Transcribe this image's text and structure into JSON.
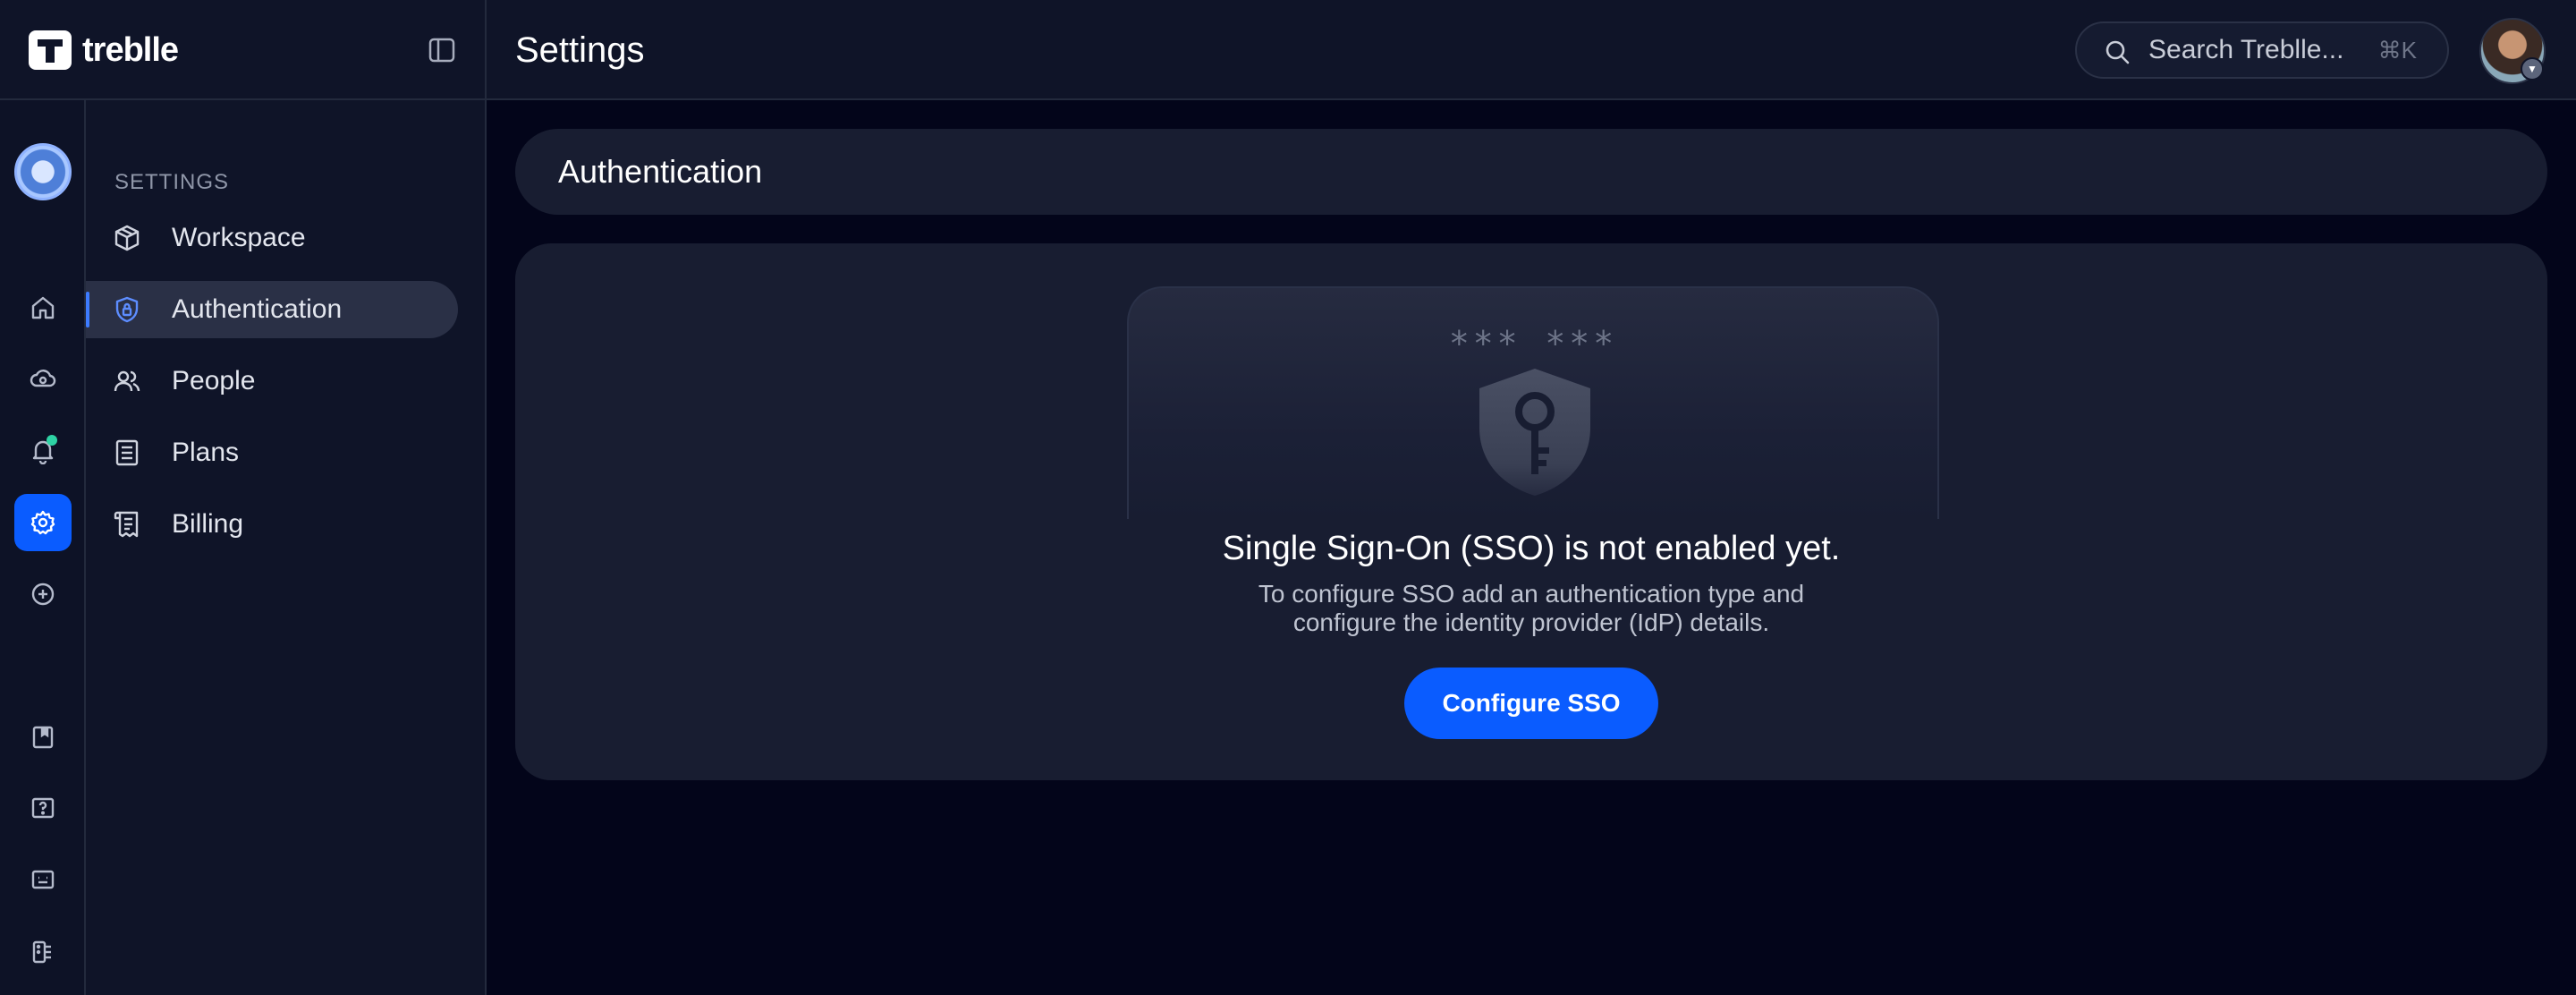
{
  "brand": {
    "name": "treblle"
  },
  "header": {
    "title": "Settings",
    "search": {
      "placeholder": "Search Treblle...",
      "shortcut": "⌘K"
    }
  },
  "rail": {
    "items": [
      {
        "icon": "home-icon"
      },
      {
        "icon": "api-cloud-icon"
      },
      {
        "icon": "bell-icon",
        "has_notification": true
      },
      {
        "icon": "gear-icon",
        "active": true
      },
      {
        "icon": "plus-circle-icon"
      },
      {
        "icon": "book-icon"
      },
      {
        "icon": "help-icon"
      },
      {
        "icon": "chat-icon"
      },
      {
        "icon": "apps-icon"
      }
    ]
  },
  "settings_nav": {
    "heading": "SETTINGS",
    "items": [
      {
        "label": "Workspace",
        "icon": "cube-icon"
      },
      {
        "label": "Authentication",
        "icon": "shield-lock-icon",
        "active": true
      },
      {
        "label": "People",
        "icon": "people-icon"
      },
      {
        "label": "Plans",
        "icon": "document-icon"
      },
      {
        "label": "Billing",
        "icon": "receipt-icon"
      }
    ]
  },
  "main": {
    "section_title": "Authentication",
    "empty_state": {
      "password_mask": "*** ***",
      "title": "Single Sign-On (SSO) is not enabled yet.",
      "description_line1": "To configure SSO add an authentication type and",
      "description_line2": "configure the identity provider (IdP) details.",
      "button_label": "Configure SSO"
    }
  },
  "colors": {
    "accent": "#0a5cff",
    "background": "#03051a",
    "panel": "#181d31",
    "notification": "#2ed3a5"
  }
}
